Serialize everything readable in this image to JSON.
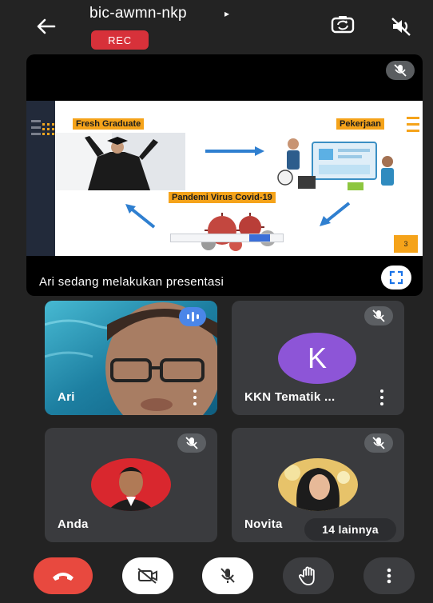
{
  "header": {
    "meeting_code": "bic-awmn-nkp",
    "title_caret": "▸",
    "rec_label": "REC"
  },
  "presentation": {
    "caption": "Ari sedang melakukan presentasi",
    "slide": {
      "label_fresh_graduate": "Fresh Graduate",
      "label_pekerjaan": "Pekerjaan",
      "label_pandemi": "Pandemi Virus Covid-19",
      "page_number": "3"
    }
  },
  "participants": [
    {
      "name": "Ari",
      "speaking": true
    },
    {
      "name": "KKN Tematik ...",
      "avatar_letter": "K",
      "muted": true
    },
    {
      "name": "Anda",
      "muted": true
    },
    {
      "name": "Novita",
      "muted": true
    }
  ],
  "others_label": "14 lainnya",
  "colors": {
    "rec_red": "#d7313a",
    "end_call_red": "#e8493f",
    "speaking_blue": "#4b86e8",
    "avatar_purple": "#8d55d7",
    "slide_accent": "#f5a31a"
  },
  "controls": [
    "end-call",
    "camera-off",
    "mic-off",
    "raise-hand",
    "more-options"
  ]
}
